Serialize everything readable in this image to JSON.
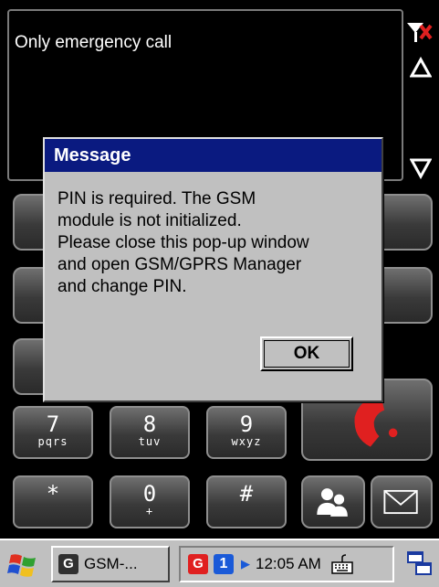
{
  "display": {
    "status_text": "Only emergency call"
  },
  "keypad": {
    "keys": [
      {
        "digit": "7",
        "letters": "pqrs"
      },
      {
        "digit": "8",
        "letters": "tuv"
      },
      {
        "digit": "9",
        "letters": "wxyz"
      },
      {
        "digit": "*",
        "letters": ""
      },
      {
        "digit": "0",
        "letters": "+"
      },
      {
        "digit": "#",
        "letters": ""
      }
    ],
    "end_call_icon": "phone-hangup-icon",
    "contacts_icon": "contacts-icon",
    "message_icon": "envelope-icon"
  },
  "dialog": {
    "title": "Message",
    "message": "PIN is required. The GSM\nmodule is not initialized.\nPlease close this pop-up window\nand open GSM/GPRS Manager\nand change PIN.",
    "ok_label": "OK"
  },
  "taskbar": {
    "task_badge": "G",
    "task_label": "GSM-...",
    "tray_badge": "G",
    "tray_number": "1",
    "time": "12:05 AM",
    "start_icon": "windows-flag-icon",
    "keyboard_icon": "keyboard-icon",
    "switcher_icon": "window-switcher-icon"
  },
  "colors": {
    "title_bar": "#0a1a80",
    "dialog_bg": "#c0c0c0",
    "end_call_red": "#e02020",
    "tray_blue": "#1a5ad8"
  }
}
